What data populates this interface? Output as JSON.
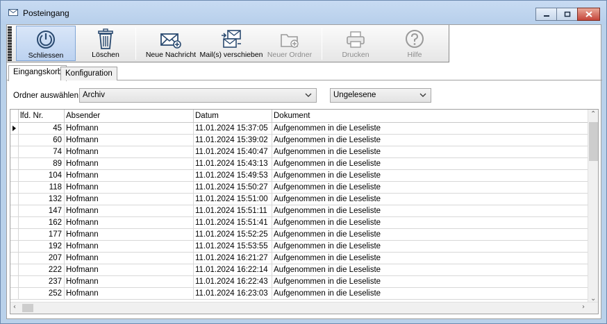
{
  "window": {
    "title": "Posteingang",
    "title_icon": "envelope-icon"
  },
  "toolbar": {
    "buttons": [
      {
        "label": "Schliessen",
        "icon": "power-icon",
        "state": "active"
      },
      {
        "label": "Löschen",
        "icon": "trash-icon",
        "state": "normal"
      },
      {
        "label": "Neue Nachricht",
        "icon": "new-mail-icon",
        "state": "normal"
      },
      {
        "label": "Mail(s) verschieben",
        "icon": "move-mail-icon",
        "state": "normal"
      },
      {
        "label": "Neuer Ordner",
        "icon": "new-folder-icon",
        "state": "disabled"
      },
      {
        "label": "Drucken",
        "icon": "printer-icon",
        "state": "disabled"
      },
      {
        "label": "Hilfe",
        "icon": "help-icon",
        "state": "disabled"
      }
    ]
  },
  "tabs": [
    {
      "label": "Eingangskorb",
      "selected": true
    },
    {
      "label": "Konfiguration",
      "selected": false
    }
  ],
  "filter": {
    "label": "Ordner auswählen",
    "folder_value": "Archiv",
    "status_value": "Ungelesene"
  },
  "grid": {
    "columns": [
      "lfd. Nr.",
      "Absender",
      "Datum",
      "Dokument"
    ],
    "rows": [
      {
        "nr": "45",
        "absender": "Hofmann",
        "datum": "11.01.2024 15:37:05",
        "dokument": "Aufgenommen in die Leseliste"
      },
      {
        "nr": "60",
        "absender": "Hofmann",
        "datum": "11.01.2024 15:39:02",
        "dokument": "Aufgenommen in die Leseliste"
      },
      {
        "nr": "74",
        "absender": "Hofmann",
        "datum": "11.01.2024 15:40:47",
        "dokument": "Aufgenommen in die Leseliste"
      },
      {
        "nr": "89",
        "absender": "Hofmann",
        "datum": "11.01.2024 15:43:13",
        "dokument": "Aufgenommen in die Leseliste"
      },
      {
        "nr": "104",
        "absender": "Hofmann",
        "datum": "11.01.2024 15:49:53",
        "dokument": "Aufgenommen in die Leseliste"
      },
      {
        "nr": "118",
        "absender": "Hofmann",
        "datum": "11.01.2024 15:50:27",
        "dokument": "Aufgenommen in die Leseliste"
      },
      {
        "nr": "132",
        "absender": "Hofmann",
        "datum": "11.01.2024 15:51:00",
        "dokument": "Aufgenommen in die Leseliste"
      },
      {
        "nr": "147",
        "absender": "Hofmann",
        "datum": "11.01.2024 15:51:11",
        "dokument": "Aufgenommen in die Leseliste"
      },
      {
        "nr": "162",
        "absender": "Hofmann",
        "datum": "11.01.2024 15:51:41",
        "dokument": "Aufgenommen in die Leseliste"
      },
      {
        "nr": "177",
        "absender": "Hofmann",
        "datum": "11.01.2024 15:52:25",
        "dokument": "Aufgenommen in die Leseliste"
      },
      {
        "nr": "192",
        "absender": "Hofmann",
        "datum": "11.01.2024 15:53:55",
        "dokument": "Aufgenommen in die Leseliste"
      },
      {
        "nr": "207",
        "absender": "Hofmann",
        "datum": "11.01.2024 16:21:27",
        "dokument": "Aufgenommen in die Leseliste"
      },
      {
        "nr": "222",
        "absender": "Hofmann",
        "datum": "11.01.2024 16:22:14",
        "dokument": "Aufgenommen in die Leseliste"
      },
      {
        "nr": "237",
        "absender": "Hofmann",
        "datum": "11.01.2024 16:22:43",
        "dokument": "Aufgenommen in die Leseliste"
      },
      {
        "nr": "252",
        "absender": "Hofmann",
        "datum": "11.01.2024 16:23:03",
        "dokument": "Aufgenommen in die Leseliste"
      }
    ]
  },
  "colors": {
    "title_bar": "#b9d1ea",
    "active_button": "#bcd2f0",
    "close_button": "#c5453a"
  }
}
